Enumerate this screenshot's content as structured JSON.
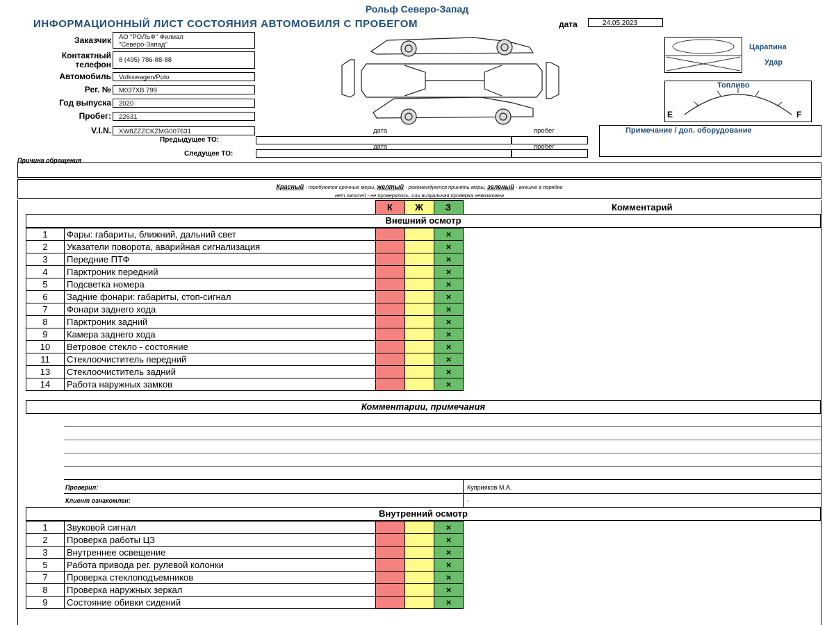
{
  "header": {
    "company": "Рольф Северо-Запад",
    "title": "ИНФОРМАЦИОННЫЙ ЛИСТ СОСТОЯНИЯ АВТОМОБИЛЯ С ПРОБЕГОМ",
    "date_label": "дата",
    "date_value": "24.05.2023"
  },
  "fields": {
    "customer_label": "Заказчик",
    "customer_line1": "АО \"РОЛЬФ\" Филиал",
    "customer_line2": "\"Северо-Запад\"",
    "phone_label1": "Контактный",
    "phone_label2": "телефон",
    "phone_value": "8 (495) 786-88-88",
    "car_label": "Автомобиль",
    "car_value": "Volkswagen/Polo",
    "reg_label": "Рег. №",
    "reg_value": "М037ХВ 799",
    "year_label": "Год выпуска",
    "year_value": "2020",
    "mileage_label": "Пробег:",
    "mileage_value": "22631",
    "vin_label": "V.I.N.",
    "vin_value": "XW8ZZZCKZMG007631"
  },
  "service": {
    "date_col": "дата",
    "mileage_col": "пробег",
    "prev_label": "Предыдущее ТО:",
    "next_label": "Следущее ТО:",
    "reason_label": "Причина обращения"
  },
  "legend": {
    "scratch": "Царапина",
    "hit": "Удар",
    "fuel": "Топливо",
    "fuel_e": "E",
    "fuel_f": "F",
    "notes": "Примечание / доп. оборудование"
  },
  "key": {
    "red": "Красный",
    "red_desc": " - требуются срочные меры, ",
    "yellow": "желтый",
    "yellow_desc": " - рекомендуется принять меры, ",
    "green": "зеленый",
    "green_desc": " - внешне в порядке",
    "line2": "нет записей - не проверялось, или визуальная проверка невозможна"
  },
  "table": {
    "col_k": "К",
    "col_zh": "Ж",
    "col_z": "З",
    "col_comment": "Комментарий",
    "mark": "×",
    "external_title": "Внешний осмотр",
    "external_items": [
      {
        "num": "1",
        "name": "Фары: габариты, ближний, дальний свет"
      },
      {
        "num": "2",
        "name": "Указатели поворота, аварийная сигнализация"
      },
      {
        "num": "3",
        "name": "Передние ПТФ"
      },
      {
        "num": "4",
        "name": "Парктроник передний"
      },
      {
        "num": "5",
        "name": "Подсветка номера"
      },
      {
        "num": "6",
        "name": "Задние фонари: габариты, стоп-сигнал"
      },
      {
        "num": "7",
        "name": "Фонари заднего хода"
      },
      {
        "num": "8",
        "name": "Парктроник задний"
      },
      {
        "num": "9",
        "name": "Камера заднего хода"
      },
      {
        "num": "10",
        "name": "Ветровое стекло - состояние"
      },
      {
        "num": "11",
        "name": "Стеклоочиститель передний"
      },
      {
        "num": "13",
        "name": "Стеклоочиститель задний"
      },
      {
        "num": "14",
        "name": "Работа наружных замков"
      }
    ],
    "comments_title": "Комментарии, примечания",
    "checked_label": "Проверил:",
    "checked_value": "Куприяков М.А.",
    "client_label": "Клиент ознакомлен:",
    "client_value": "-",
    "internal_title": "Внутренний осмотр",
    "internal_items": [
      {
        "num": "1",
        "name": "Звуковой сигнал"
      },
      {
        "num": "2",
        "name": "Проверка работы ЦЗ"
      },
      {
        "num": "3",
        "name": "Внутреннее освещение"
      },
      {
        "num": "5",
        "name": "Работа привода рег. рулевой колонки"
      },
      {
        "num": "7",
        "name": "Проверка стеклоподъемников"
      },
      {
        "num": "8",
        "name": "Проверка наружных зеркал"
      },
      {
        "num": "9",
        "name": "Состояние обивки сидений"
      }
    ]
  }
}
